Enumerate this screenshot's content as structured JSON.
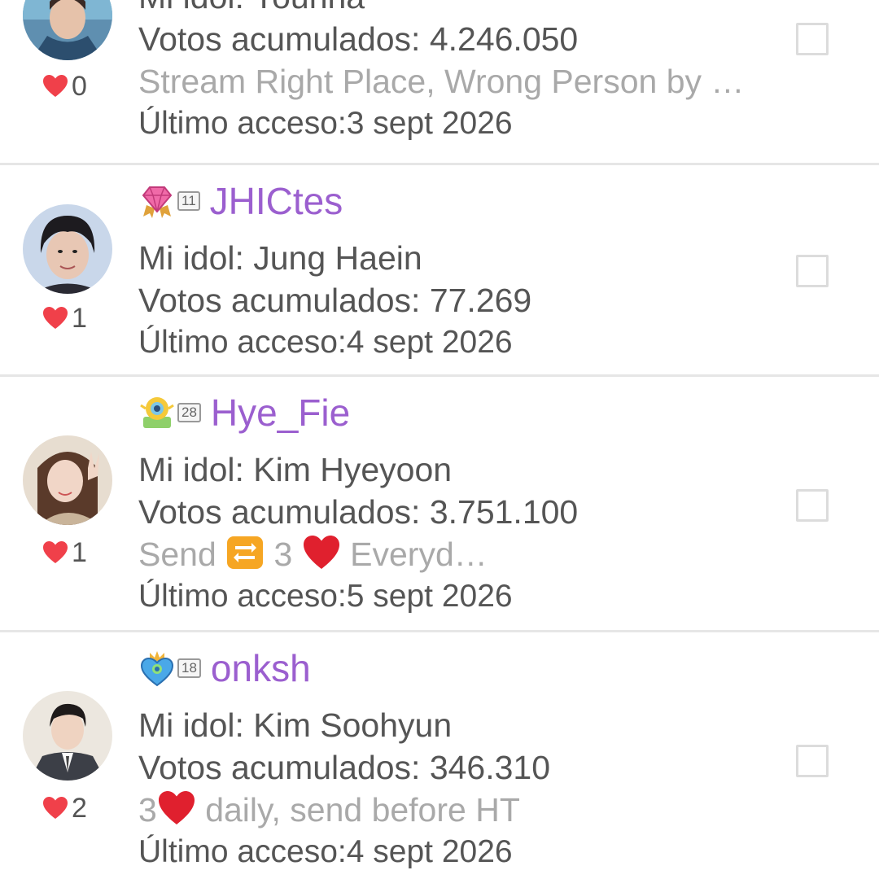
{
  "users": [
    {
      "username": "",
      "idol": "Mi idol: Younna",
      "votes": "Votos acumulados: 4.246.050",
      "status": "Stream Right Place, Wrong Person by …",
      "last_access": "Último acceso:3 sept 2026",
      "likes": "0",
      "badge_level": "",
      "badge_icon": "none",
      "avatar_icon": "avatar-blue-jacket-icon"
    },
    {
      "username": "JHICtes",
      "idol": "Mi idol: Jung Haein",
      "votes": "Votos acumulados: 77.269",
      "status": "",
      "last_access": "Último acceso:4 sept 2026",
      "likes": "1",
      "badge_level": "11",
      "badge_icon": "pink-diamond-badge-icon",
      "avatar_icon": "avatar-dark-hair-icon"
    },
    {
      "username": "Hye_Fie",
      "idol": "Mi idol: Kim Hyeyoon",
      "votes": "Votos acumulados: 3.751.100",
      "status_parts": {
        "prefix": "Send ",
        "middle": " 3 ",
        "suffix": " Everyd…"
      },
      "last_access": "Último acceso:5 sept 2026",
      "likes": "1",
      "badge_level": "28",
      "badge_icon": "sunflower-badge-icon",
      "avatar_icon": "avatar-peace-sign-icon"
    },
    {
      "username": "onksh",
      "idol": "Mi idol: Kim Soohyun",
      "votes": "Votos acumulados: 346.310",
      "status_parts": {
        "prefix": "3",
        "suffix": " daily, send before HT"
      },
      "last_access": "Último acceso:4 sept 2026",
      "likes": "2",
      "badge_level": "18",
      "badge_icon": "blue-heart-badge-icon",
      "avatar_icon": "avatar-suit-icon"
    }
  ],
  "colors": {
    "username": "#9b5fcf",
    "text": "#555555",
    "status_text": "#a9a9a9",
    "heart": "#f0404a",
    "divider": "#e6e6e6"
  }
}
